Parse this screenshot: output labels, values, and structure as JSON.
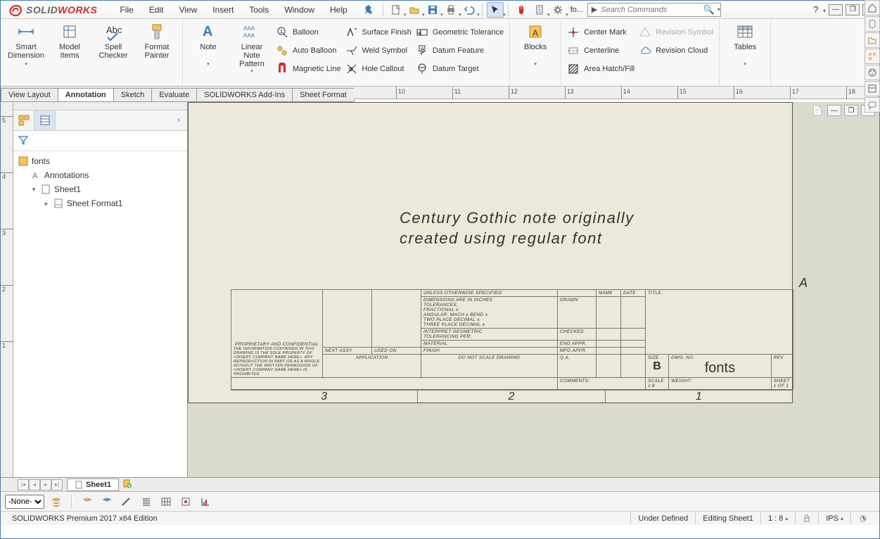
{
  "app": {
    "logo_solid": "SOLID",
    "logo_works": "WORKS"
  },
  "menus": [
    "File",
    "Edit",
    "View",
    "Insert",
    "Tools",
    "Window",
    "Help"
  ],
  "doc_name": "fo...",
  "search_placeholder": "Search Commands",
  "ribbon": {
    "smart_dim": "Smart Dimension",
    "model_items": "Model Items",
    "spell": "Spell Checker",
    "format": "Format Painter",
    "note": "Note",
    "linear_note": "Linear Note Pattern",
    "balloon": "Balloon",
    "auto_balloon": "Auto Balloon",
    "magnetic": "Magnetic Line",
    "surface": "Surface Finish",
    "weld": "Weld Symbol",
    "hole": "Hole Callout",
    "geo_tol": "Geometric Tolerance",
    "datum_feat": "Datum Feature",
    "datum_target": "Datum Target",
    "blocks": "Blocks",
    "center_mark": "Center Mark",
    "centerline": "Centerline",
    "area_hatch": "Area Hatch/Fill",
    "rev_symbol": "Revision Symbol",
    "rev_cloud": "Revision Cloud",
    "tables": "Tables"
  },
  "tabs": {
    "view_layout": "View Layout",
    "annotation": "Annotation",
    "sketch": "Sketch",
    "evaluate": "Evaluate",
    "addins": "SOLIDWORKS Add-Ins",
    "sheet_format": "Sheet Format"
  },
  "ruler_marks": [
    "10",
    "11",
    "12",
    "13",
    "14",
    "15",
    "16",
    "17",
    "18"
  ],
  "vruler_marks": [
    "5",
    "4",
    "3",
    "2",
    "1"
  ],
  "tree": {
    "root": "fonts",
    "ann": "Annotations",
    "sheet": "Sheet1",
    "sf": "Sheet Format1"
  },
  "note_line1": "Century Gothic note originally",
  "note_line2": "created using regular font",
  "titleblock": {
    "A": "A",
    "unless": "UNLESS OTHERWISE SPECIFIED:",
    "dims": "DIMENSIONS ARE IN INCHES",
    "tol": "TOLERANCES:",
    "frac": "FRACTIONAL ±",
    "ang": "ANGULAR: MACH ±   BEND ±",
    "two": "TWO PLACE DECIMAL    ±",
    "three": "THREE PLACE DECIMAL  ±",
    "interp": "INTERPRET GEOMETRIC",
    "tolp": "TOLERANCING PER:",
    "mat": "MATERIAL",
    "fin": "FINISH",
    "dns": "DO NOT SCALE DRAWING",
    "prop": "PROPRIETARY AND CONFIDENTIAL",
    "prop_text": "THE INFORMATION CONTAINED IN THIS DRAWING IS THE SOLE PROPERTY OF <INSERT COMPANY NAME HERE>. ANY REPRODUCTION IN PART OR AS A WHOLE WITHOUT THE WRITTEN PERMISSION OF <INSERT COMPANY NAME HERE> IS PROHIBITED.",
    "next": "NEXT ASSY",
    "used": "USED ON",
    "app": "APPLICATION",
    "name": "NAME",
    "date": "DATE",
    "drawn": "DRAWN",
    "checked": "CHECKED",
    "eng": "ENG APPR.",
    "mfg": "MFG APPR.",
    "qa": "Q.A.",
    "comm": "COMMENTS:",
    "title": "TITLE:",
    "size": "SIZE",
    "size_v": "B",
    "dwgno": "DWG.  NO.",
    "dwg_v": "fonts",
    "rev": "REV",
    "scale": "SCALE: 1:8",
    "weight": "WEIGHT:",
    "sheet": "SHEET 1 OF 1"
  },
  "coords": [
    "3",
    "2",
    "1"
  ],
  "sheet_tab": "Sheet1",
  "layer_sel": "-None-",
  "status": {
    "edition": "SOLIDWORKS Premium 2017 x64 Edition",
    "under": "Under Defined",
    "editing": "Editing Sheet1",
    "zoom": "1 : 8",
    "units": "IPS"
  }
}
